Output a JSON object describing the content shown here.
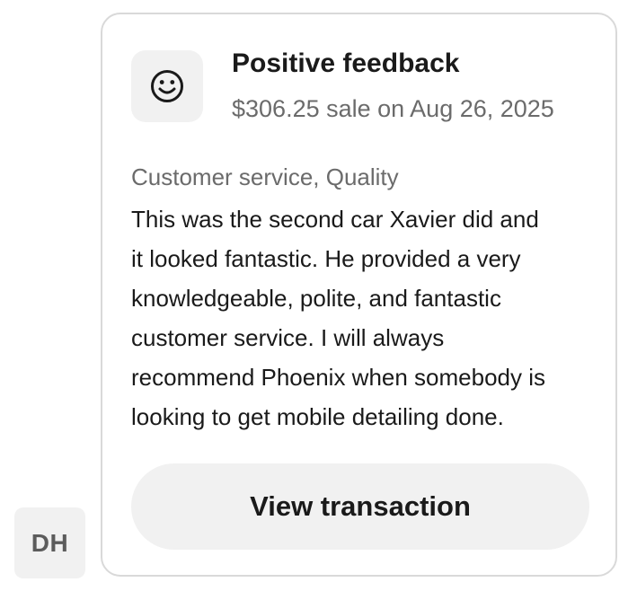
{
  "avatar": {
    "initials": "DH"
  },
  "feedback": {
    "icon": "smiley-face-icon",
    "title": "Positive feedback",
    "subtitle": "$306.25 sale on Aug 26, 2025",
    "tags": "Customer service, Quality",
    "comment_lines": [
      "This was the second car Xavier did and",
      "it looked fantastic. He provided a very",
      "knowledgeable, polite, and fantastic",
      "customer service. I will always",
      "recommend Phoenix when somebody is",
      "looking to get mobile detailing done."
    ],
    "button_label": "View transaction"
  },
  "colors": {
    "text_primary": "#1a1a1a",
    "text_secondary": "#6b6b6b",
    "tile_background": "#f1f1f1",
    "card_border": "#d9d9d9"
  }
}
